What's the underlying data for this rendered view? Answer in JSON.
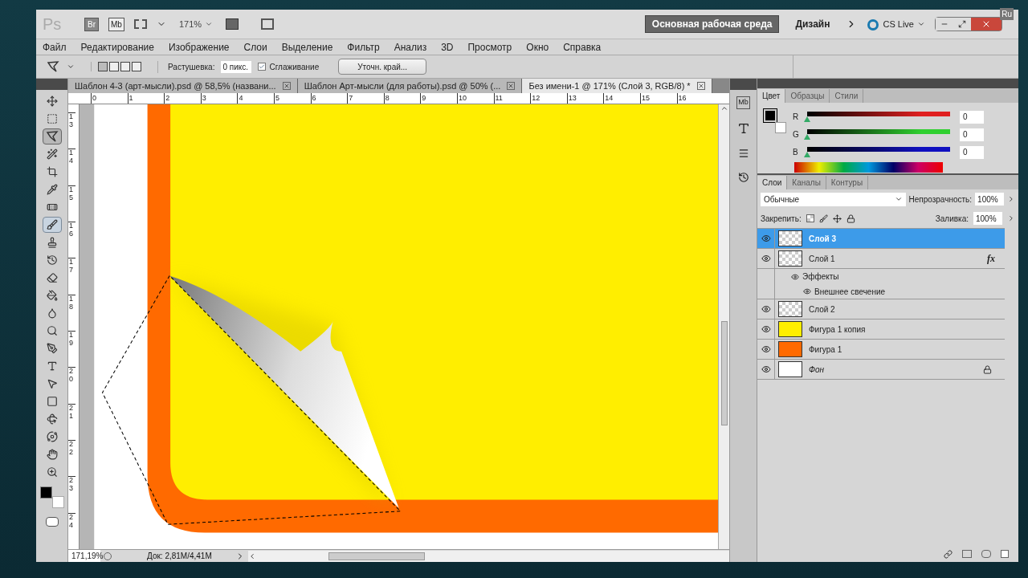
{
  "app": {
    "logo": "Ps",
    "bridge": "Br",
    "mini_bridge": "Mb",
    "zoom": "171%",
    "keyboard_layout": "Ru",
    "mini_bridge_panel": "Mb"
  },
  "workspaces": [
    {
      "label": "Основная рабочая среда",
      "selected": true
    },
    {
      "label": "Дизайн",
      "selected": false
    }
  ],
  "cs_live": "CS Live",
  "menu": [
    "Файл",
    "Редактирование",
    "Изображение",
    "Слои",
    "Выделение",
    "Фильтр",
    "Анализ",
    "3D",
    "Просмотр",
    "Окно",
    "Справка"
  ],
  "options": {
    "feather_label": "Растушевка:",
    "feather_value": "0 пикс.",
    "antialias_label": "Сглаживание",
    "antialias_checked": true,
    "refine_edge": "Уточн. край..."
  },
  "doc_tabs": [
    {
      "title": "Шаблон 4-3 (арт-мысли).psd @ 58,5% (названи...",
      "selected": false
    },
    {
      "title": "Шаблон Арт-мысли (для работы).psd @ 50% (...",
      "selected": false
    },
    {
      "title": "Без имени-1 @ 171% (Слой 3, RGB/8) *",
      "selected": true
    }
  ],
  "ruler_h": [
    "0",
    "1",
    "2",
    "3",
    "4",
    "5",
    "6",
    "7",
    "8",
    "9",
    "10",
    "11",
    "12",
    "13",
    "14",
    "15",
    "16"
  ],
  "ruler_v": [
    "13",
    "14",
    "15",
    "16",
    "17",
    "18",
    "19",
    "20",
    "21",
    "22",
    "23",
    "24"
  ],
  "tools": [
    {
      "kind": "move",
      "selected": false,
      "hovered": false
    },
    {
      "kind": "marquee",
      "selected": false,
      "hovered": false
    },
    {
      "kind": "lasso",
      "selected": true,
      "hovered": false
    },
    {
      "kind": "wand",
      "selected": false,
      "hovered": false
    },
    {
      "kind": "crop",
      "selected": false,
      "hovered": false
    },
    {
      "kind": "eyedropper",
      "selected": false,
      "hovered": false
    },
    {
      "kind": "heal",
      "selected": false,
      "hovered": false
    },
    {
      "kind": "brush",
      "selected": false,
      "hovered": true
    },
    {
      "kind": "stamp",
      "selected": false,
      "hovered": false
    },
    {
      "kind": "history",
      "selected": false,
      "hovered": false
    },
    {
      "kind": "eraser",
      "selected": false,
      "hovered": false
    },
    {
      "kind": "bucket",
      "selected": false,
      "hovered": false
    },
    {
      "kind": "blur",
      "selected": false,
      "hovered": false
    },
    {
      "kind": "dodge",
      "selected": false,
      "hovered": false
    },
    {
      "kind": "pen",
      "selected": false,
      "hovered": false
    },
    {
      "kind": "type",
      "selected": false,
      "hovered": false
    },
    {
      "kind": "path",
      "selected": false,
      "hovered": false
    },
    {
      "kind": "shape",
      "selected": false,
      "hovered": false
    },
    {
      "kind": "rotate3d",
      "selected": false,
      "hovered": false
    },
    {
      "kind": "orbit3d",
      "selected": false,
      "hovered": false
    },
    {
      "kind": "hand",
      "selected": false,
      "hovered": false
    },
    {
      "kind": "zoom",
      "selected": false,
      "hovered": false
    }
  ],
  "swatches": [
    {
      "kind": "foreground",
      "color": "#000000"
    },
    {
      "kind": "background",
      "color": "#ffffff"
    }
  ],
  "status": {
    "zoom": "171,19%",
    "doc": "Док: 2,81M/4,41M"
  },
  "color_panel": {
    "tabs": [
      {
        "label": "Цвет",
        "selected": true
      },
      {
        "label": "Образцы",
        "selected": false
      },
      {
        "label": "Стили",
        "selected": false
      }
    ],
    "channels": [
      {
        "name": "R",
        "color": "#e02020",
        "level": 0,
        "value": "0"
      },
      {
        "name": "G",
        "color": "#30d030",
        "level": 0,
        "value": "0"
      },
      {
        "name": "B",
        "color": "#1010c0",
        "level": 0,
        "value": "0"
      }
    ]
  },
  "layers_panel": {
    "tabs": [
      {
        "label": "Слои",
        "selected": true
      },
      {
        "label": "Каналы",
        "selected": false
      },
      {
        "label": "Контуры",
        "selected": false
      }
    ],
    "blend_mode": "Обычные",
    "opacity_label": "Непрозрачность:",
    "opacity": "100%",
    "lock_label": "Закрепить:",
    "fill_label": "Заливка:",
    "fill": "100%",
    "layers": [
      {
        "name": "Слой 3",
        "kind": "transparent",
        "visible": true,
        "selected": true,
        "locked": false,
        "italic": false
      },
      {
        "name": "Слой 1",
        "kind": "transparent",
        "visible": true,
        "selected": false,
        "locked": false,
        "italic": false,
        "fx_badge": "fx",
        "effects": [
          "Эффекты",
          "Внешнее свечение"
        ]
      },
      {
        "name": "Слой 2",
        "kind": "transparent",
        "visible": true,
        "selected": false,
        "locked": false,
        "italic": false
      },
      {
        "name": "Фигура 1 копия",
        "kind": "filled",
        "color": "#ffee00",
        "visible": true,
        "selected": false,
        "locked": false,
        "italic": false
      },
      {
        "name": "Фигура 1",
        "kind": "filled",
        "color": "#ff6a00",
        "visible": true,
        "selected": false,
        "locked": false,
        "italic": false
      },
      {
        "name": "Фон",
        "kind": "filled",
        "color": "#ffffff",
        "visible": true,
        "selected": false,
        "locked": true,
        "italic": true
      }
    ]
  }
}
